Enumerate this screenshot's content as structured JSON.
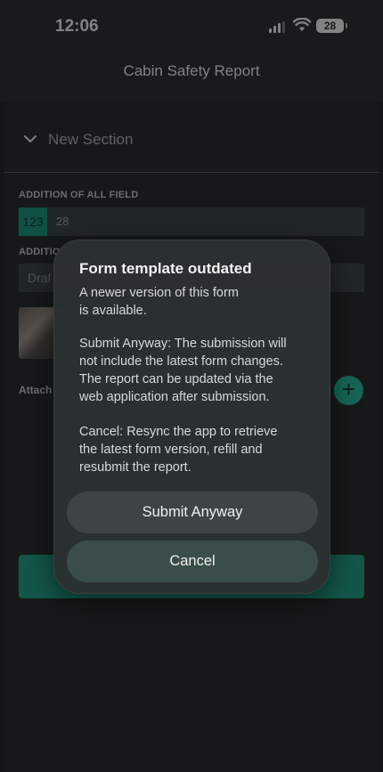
{
  "status_bar": {
    "time": "12:06",
    "battery": "28"
  },
  "header": {
    "title": "Cabin Safety Report"
  },
  "section": {
    "title": "New Section"
  },
  "fields": {
    "addition_label": "ADDITION OF ALL  FIELD",
    "number_badge": "123",
    "number_value": "28",
    "second_label": "ADDITIO",
    "draft_value": "Draf",
    "attach_label": "Attach",
    "add_icon": "+"
  },
  "dialog": {
    "title": "Form template outdated",
    "line1": "A newer version of this form",
    "line2": "is available.",
    "submit_para_1": "Submit Anyway: The submission will",
    "submit_para_2": "not include the latest form changes.",
    "submit_para_3": "The report can be updated via the",
    "submit_para_4": "web application after submission.",
    "cancel_para_1": "Cancel: Resync the app to retrieve",
    "cancel_para_2": "the latest form version, refill and",
    "cancel_para_3": "resubmit the report.",
    "submit_label": "Submit Anyway",
    "cancel_label": "Cancel"
  },
  "colors": {
    "accent": "#16826f",
    "background": "#1b1e1f",
    "dialog": "#2c3031"
  },
  "icons": [
    "chevron-down-icon",
    "signal-icon",
    "wifi-icon",
    "battery-icon",
    "add-icon",
    "image-thumbnail"
  ]
}
